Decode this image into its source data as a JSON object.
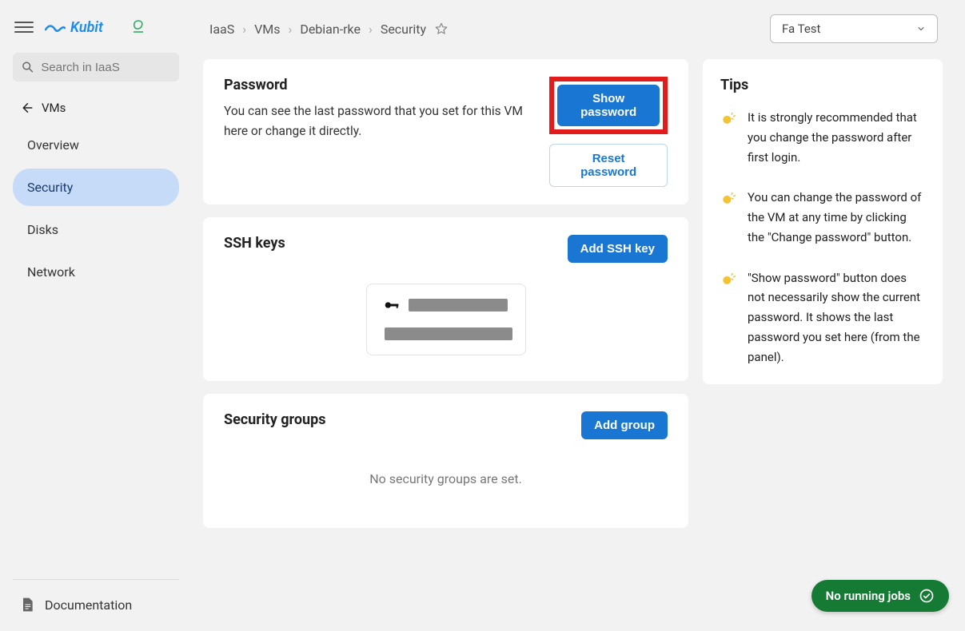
{
  "brand": {
    "name": "Kubit"
  },
  "search": {
    "placeholder": "Search in IaaS"
  },
  "sidebar": {
    "back_label": "VMs",
    "items": [
      {
        "label": "Overview"
      },
      {
        "label": "Security"
      },
      {
        "label": "Disks"
      },
      {
        "label": "Network"
      }
    ],
    "docs_label": "Documentation"
  },
  "breadcrumbs": [
    "IaaS",
    "VMs",
    "Debian-rke",
    "Security"
  ],
  "project_selector": {
    "value": "Fa Test"
  },
  "password_section": {
    "title": "Password",
    "description": "You can see the last password that you set for this VM here or change it directly.",
    "show_btn": "Show password",
    "reset_btn": "Reset password"
  },
  "ssh_section": {
    "title": "SSH keys",
    "add_btn": "Add SSH key"
  },
  "secgroups_section": {
    "title": "Security groups",
    "add_btn": "Add group",
    "empty": "No security groups are set."
  },
  "tips": {
    "title": "Tips",
    "items": [
      "It is strongly recommended that you change the password after first login.",
      "You can change the password of the VM at any time by clicking the \"Change password\" button.",
      "\"Show password\" button does not necessarily show the current password. It shows the last password you set here (from the panel)."
    ]
  },
  "jobs_badge": {
    "label": "No running jobs"
  }
}
